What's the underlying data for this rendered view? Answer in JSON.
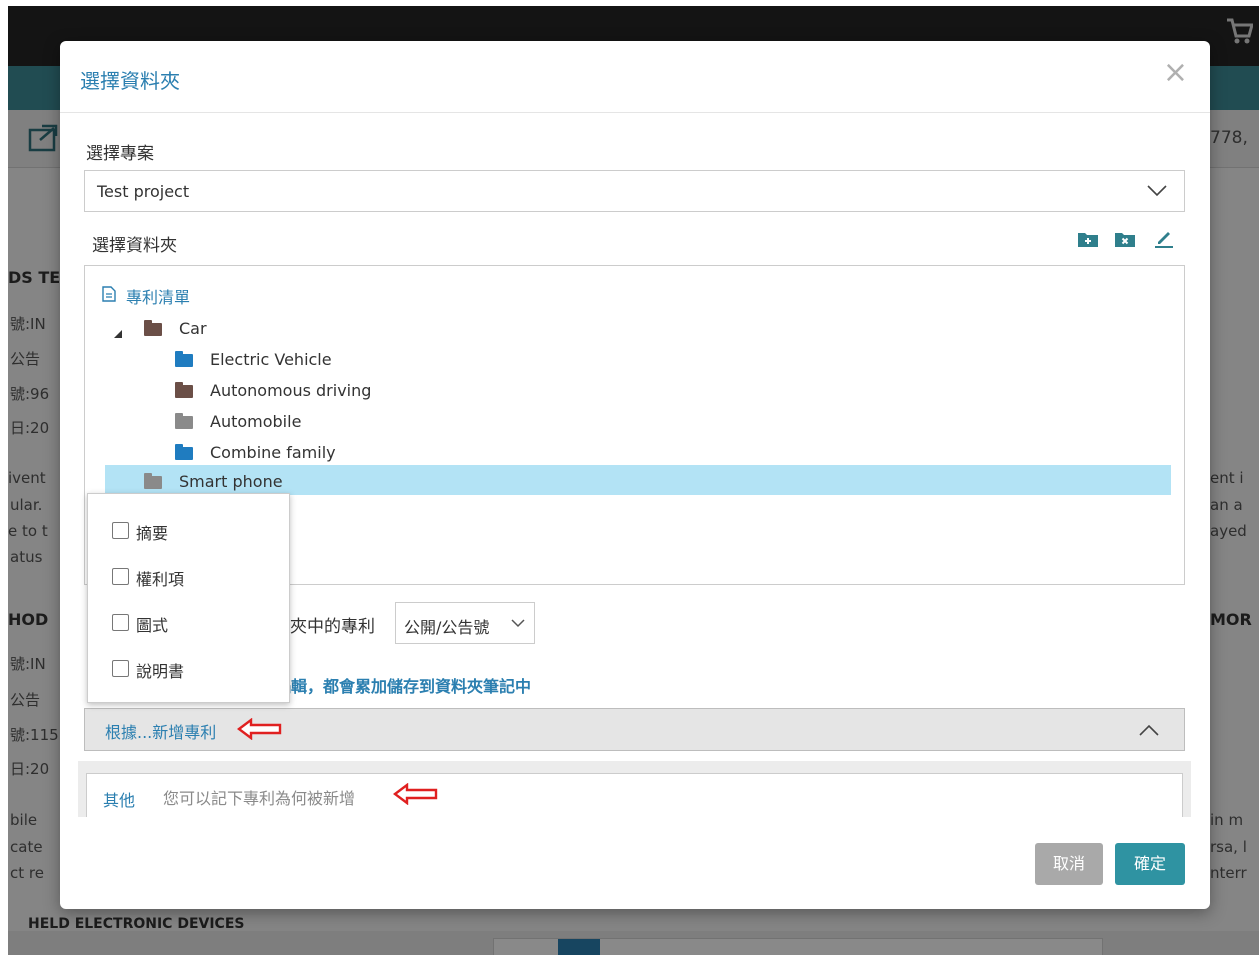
{
  "background": {
    "fragments": [
      "778,",
      "DS TE",
      "號:IN",
      "公告",
      "號:96",
      "日:20",
      "ivent",
      "ular.",
      "e to t",
      "atus",
      "HOD",
      "號:IN",
      "公告",
      "號:115",
      "日:20",
      "bile",
      "cate",
      "ct re",
      "ent i",
      "an a",
      "ayed",
      "MOR",
      "in m",
      "rsa, l",
      "nterr",
      "HELD ELECTRONIC DEVICES"
    ]
  },
  "modal": {
    "title": "選擇資料夾",
    "close_icon": "×",
    "project_label": "選擇專案",
    "project_value": "Test project",
    "folder_label": "選擇資料夾",
    "tree": {
      "root": "專利清單",
      "car": "Car",
      "children": [
        "Electric Vehicle",
        "Autonomous driving",
        "Automobile",
        "Combine family"
      ],
      "selected": "Smart phone"
    },
    "sort_label": "夾中的專利",
    "sort_value": "公開/公告號",
    "note_text": "編輯，都會累加儲存到資料夾筆記中",
    "collapse_label": "根據...新增專利",
    "other_label": "其他",
    "other_placeholder": "您可以記下專利為何被新增",
    "cancel": "取消",
    "ok": "確定"
  },
  "dropdown": {
    "items": [
      "摘要",
      "權利項",
      "圖式",
      "說明書"
    ]
  },
  "colors": {
    "accent": "#2b7fb0",
    "teal": "#2f93a2",
    "selected_row": "#b3e3f5",
    "folder_blue": "#1f7cc0",
    "folder_brown": "#6b4f47",
    "folder_gray": "#8a8a8a",
    "arrow_red": "#e02020"
  }
}
